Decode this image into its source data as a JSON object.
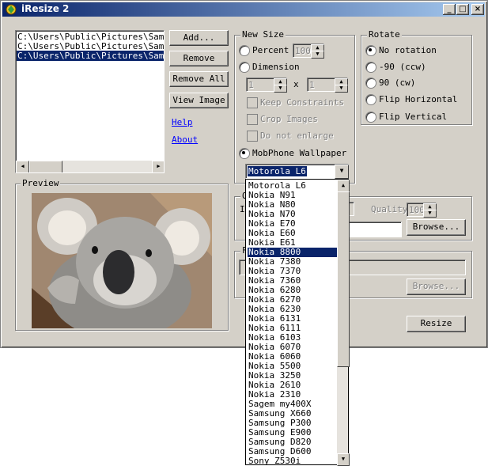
{
  "window": {
    "title": "iResize 2",
    "buttons": {
      "minimize": "_",
      "maximize": "□",
      "close": "×"
    }
  },
  "file_list": {
    "items": [
      "C:\\Users\\Public\\Pictures\\Sample",
      "C:\\Users\\Public\\Pictures\\Sample",
      "C:\\Users\\Public\\Pictures\\Sample"
    ],
    "selected_index": 2
  },
  "actions": {
    "add": "Add...",
    "remove": "Remove",
    "remove_all": "Remove All",
    "view_image": "View Image",
    "help": "Help",
    "about": "About"
  },
  "preview": {
    "label": "Preview"
  },
  "new_size": {
    "label": "New Size",
    "percent_label": "Percent",
    "percent_value": "100",
    "dimension_label": "Dimension",
    "width_value": "1",
    "height_value": "1",
    "times": "x",
    "keep_constraints": "Keep Constraints",
    "crop_images": "Crop Images",
    "do_not_enlarge": "Do not enlarge",
    "mobphone_label": "MobPhone Wallpaper",
    "selected_model": "Motorola L6"
  },
  "rotate": {
    "label": "Rotate",
    "options": [
      "No rotation",
      "-90 (ccw)",
      "90 (cw)",
      "Flip Horizontal",
      "Flip Vertical"
    ],
    "selected_index": 0
  },
  "output": {
    "group_label_fragment": "O",
    "format_label_fragment": "I",
    "quality_label": "Quality",
    "quality_value": "100",
    "browse_label": "Browse...",
    "folder_label_fragment": "F",
    "browse2_label": "Browse...",
    "resize_label": "Resize"
  },
  "dropdown": {
    "items": [
      "Motorola L6",
      "Nokia N91",
      "Nokia N80",
      "Nokia N70",
      "Nokia E70",
      "Nokia E60",
      "Nokia E61",
      "Nokia 8800",
      "Nokia 7380",
      "Nokia 7370",
      "Nokia 7360",
      "Nokia 6280",
      "Nokia 6270",
      "Nokia 6230",
      "Nokia 6131",
      "Nokia 6111",
      "Nokia 6103",
      "Nokia 6070",
      "Nokia 6060",
      "Nokia 5500",
      "Nokia 3250",
      "Nokia 2610",
      "Nokia 2310",
      "Sagem my400X",
      "Samsung X660",
      "Samsung P300",
      "Samsung E900",
      "Samsung D820",
      "Samsung D600",
      "Sony Z530i"
    ],
    "highlighted_index": 7
  },
  "colors": {
    "face": "#d4d0c8",
    "selection": "#0a246a",
    "link": "#0000ff",
    "title_start": "#0a246a",
    "title_end": "#a6caf0"
  }
}
